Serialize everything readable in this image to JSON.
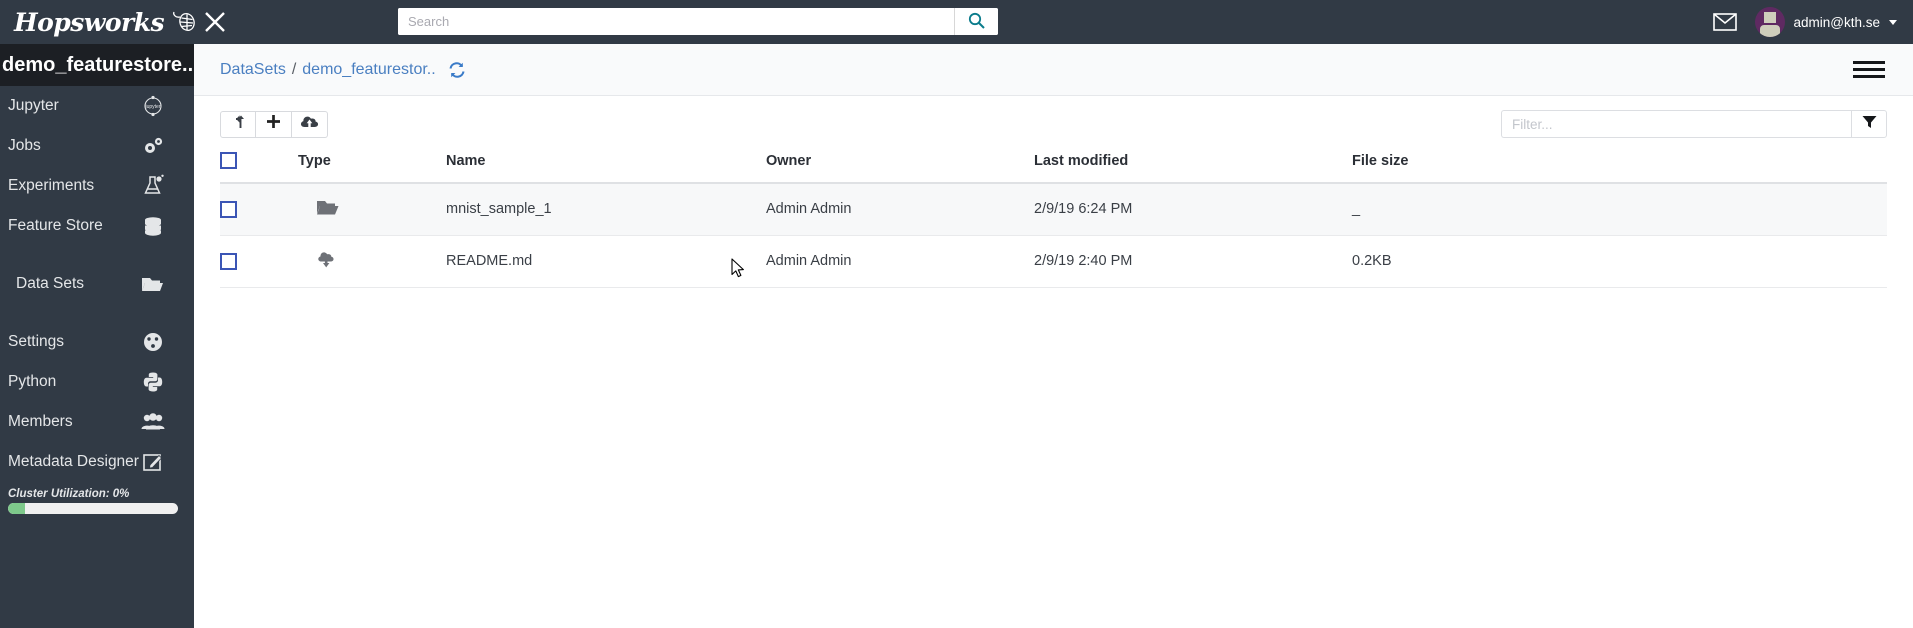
{
  "topbar": {
    "logo_text": "Hopsworks",
    "logo_icon": "hops-leaf-icon",
    "close_icon": "close-x-icon",
    "search_placeholder": "Search",
    "search_value": "",
    "search_icon": "search-icon",
    "mail_icon": "mail-envelope-icon",
    "user_email": "admin@kth.se",
    "avatar_icon": "user-avatar",
    "caret_icon": "chevron-down-icon"
  },
  "sidebar": {
    "project_title": "demo_featurestore...",
    "items": [
      {
        "label": "Jupyter",
        "icon": "jupyter-icon"
      },
      {
        "label": "Jobs",
        "icon": "gears-icon"
      },
      {
        "label": "Experiments",
        "icon": "flask-experiment-icon"
      },
      {
        "label": "Feature Store",
        "icon": "database-stack-icon"
      },
      {
        "label": "Data Sets",
        "icon": "open-folder-icon"
      },
      {
        "label": "Settings",
        "icon": "gauge-icon"
      },
      {
        "label": "Python",
        "icon": "python-icon"
      },
      {
        "label": "Members",
        "icon": "people-group-icon"
      },
      {
        "label": "Metadata Designer",
        "icon": "edit-square-icon"
      }
    ],
    "cluster": {
      "label": "Cluster Utilization: 0%",
      "percent": 0,
      "fill_color": "#7ec98b"
    }
  },
  "main": {
    "breadcrumb": {
      "root": "DataSets",
      "separator": "/",
      "current": "demo_featurestor..",
      "refresh_icon": "refresh-icon",
      "link_color": "#4a7fc1"
    },
    "menu_icon": "hamburger-menu-icon",
    "toolbar": {
      "buttons": [
        {
          "name": "navigate-up-button",
          "icon": "arrow-up-turn-icon"
        },
        {
          "name": "new-item-button",
          "icon": "plus-icon"
        },
        {
          "name": "upload-button",
          "icon": "cloud-upload-icon"
        }
      ]
    },
    "filter": {
      "placeholder": "Filter...",
      "value": "",
      "icon": "funnel-filter-icon"
    },
    "table": {
      "columns": [
        "",
        "Type",
        "Name",
        "Owner",
        "Last modified",
        "File size"
      ],
      "rows": [
        {
          "checked": false,
          "type_icon": "folder-icon",
          "name": "mnist_sample_1",
          "owner": "Admin Admin",
          "modified": "2/9/19 6:24 PM",
          "size": "_",
          "hovered": true
        },
        {
          "checked": false,
          "type_icon": "cloud-download-icon",
          "name": "README.md",
          "owner": "Admin Admin",
          "modified": "2/9/19 2:40 PM",
          "size": "0.2KB",
          "hovered": false
        }
      ]
    }
  }
}
